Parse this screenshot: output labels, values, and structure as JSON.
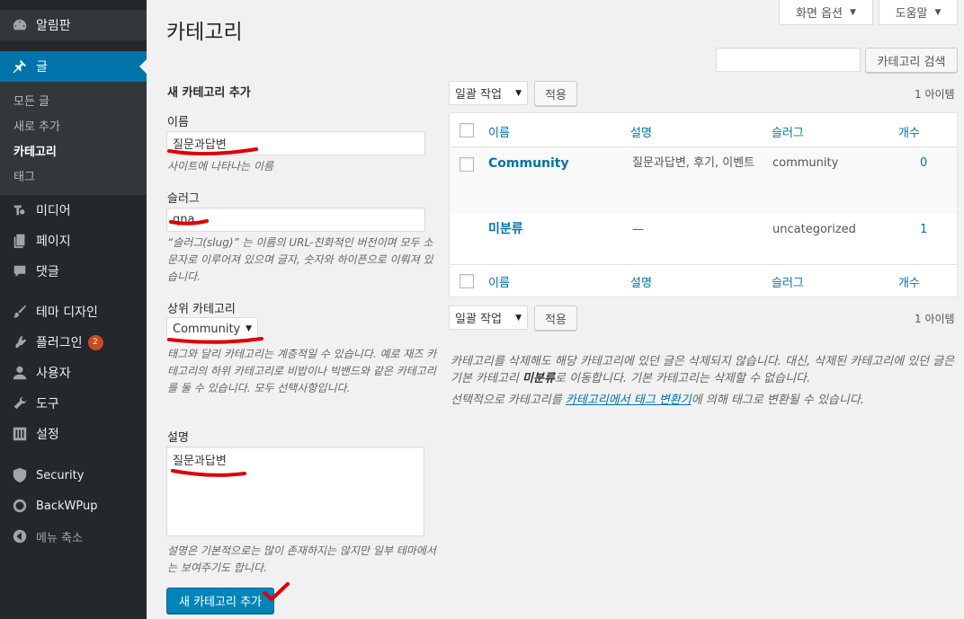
{
  "sidebar": {
    "dashboard": "알림판",
    "posts": "글",
    "posts_submenu": [
      "모든 글",
      "새로 추가",
      "카테고리",
      "태그"
    ],
    "media": "미디어",
    "pages": "페이지",
    "comments": "댓글",
    "appearance": "테마 디자인",
    "plugins": "플러그인",
    "plugins_badge": "2",
    "users": "사용자",
    "tools": "도구",
    "settings": "설정",
    "security": "Security",
    "backwpup": "BackWPup",
    "collapse": "메뉴 축소"
  },
  "header": {
    "title": "카테고리",
    "screen_options": "화면 옵션",
    "help": "도움말",
    "search_value": "",
    "search_button": "카테고리 검색"
  },
  "form": {
    "title": "새 카테고리 추가",
    "name_label": "이름",
    "name_value": "질문과답변",
    "name_help": "사이트에 나타나는 이름",
    "slug_label": "슬러그",
    "slug_value": "qna",
    "slug_help": "“슬러그(slug)” 는 이름의 URL-친화적인 버전이며 모두 소문자로 이루어져 있으며 글자, 숫자와 하이픈으로 이뤄져 있습니다.",
    "parent_label": "상위 카테고리",
    "parent_value": "Community",
    "parent_help": "태그와 달리 카테고리는 계층적일 수 있습니다. 예로 재즈 카테고리의 하위 카테고리로 비밥이나 빅밴드와 같은 카테고리를 둘 수 있습니다. 모두 선택사항입니다.",
    "desc_label": "설명",
    "desc_value": "질문과답변",
    "desc_help": "설명은 기본적으로는 많이 존재하지는 않지만 일부 테마에서는 보여주기도 합니다.",
    "submit": "새 카테고리 추가"
  },
  "table": {
    "bulk_action": "일괄 작업",
    "apply": "적용",
    "item_count": "1 아이템",
    "columns": [
      "이름",
      "설명",
      "슬러그",
      "개수"
    ],
    "rows": [
      {
        "name": "Community",
        "description": "질문과답변, 후기, 이벤트",
        "slug": "community",
        "count": "0"
      },
      {
        "name": "미분류",
        "description": "—",
        "slug": "uncategorized",
        "count": "1"
      }
    ]
  },
  "notes": {
    "line1_part1": "카테고리를 삭제해도 해당 카테고리에 있던 글은 삭제되지 않습니다. 대신, 삭제된 카테고리에 있던 글은 기본 카테고리 ",
    "line1_bold": "미분류",
    "line1_part2": "로 이동합니다. 기본 카테고리는 삭제할 수 없습니다.",
    "line2_part1": "선택적으로 카테고리를 ",
    "line2_link": "카테고리에서 태그 변환기",
    "line2_part2": "에 의해 태그로 변환될 수 있습니다."
  },
  "colors": {
    "sidebar_bg": "#23282d",
    "active_menu": "#0073aa",
    "primary_button": "#0085ba",
    "annotation_red": "#e00000"
  }
}
